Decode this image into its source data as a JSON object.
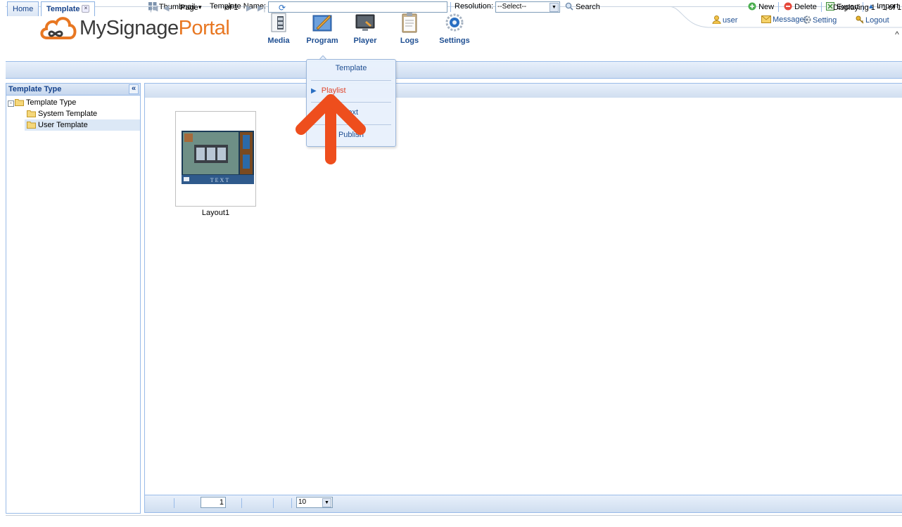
{
  "app": {
    "logo_text_1": "MySignage",
    "logo_text_2": "Portal"
  },
  "nav": [
    {
      "label": "Media",
      "icon": "film-document-icon"
    },
    {
      "label": "Program",
      "icon": "program-pen-icon"
    },
    {
      "label": "Player",
      "icon": "monitor-icon"
    },
    {
      "label": "Logs",
      "icon": "clipboard-icon"
    },
    {
      "label": "Settings",
      "icon": "gear-icon"
    }
  ],
  "topbar": {
    "user": "user",
    "message": "Message(",
    "setting": "Setting",
    "logout": "Logout"
  },
  "tabs": [
    {
      "label": "Home",
      "active": false
    },
    {
      "label": "Template",
      "active": true
    }
  ],
  "left_panel": {
    "title": "Template Type",
    "collapse_glyph": "«",
    "tree": {
      "root": "Template Type",
      "children": [
        "System Template",
        "User Template"
      ],
      "selected": "User Template"
    }
  },
  "toolbar": {
    "view_mode": "Thumbnail",
    "name_label": "Template Name:",
    "name_value": "",
    "resolution_label": "Resolution:",
    "resolution_selected": "--Select--",
    "search_label": "Search",
    "new_label": "New",
    "delete_label": "Delete",
    "export_label": "Export",
    "import_label": "Import"
  },
  "grid": {
    "items": [
      {
        "name": "Layout1",
        "thumb_text": "TEXT"
      }
    ]
  },
  "paging": {
    "page_label": "Page",
    "page_value": "1",
    "of_label": "of 1",
    "page_size": "10",
    "display_text": "Displaying 1 - 1 of 1"
  },
  "program_menu": {
    "items": [
      "Template",
      "Playlist",
      "Text",
      "Publish"
    ],
    "highlighted": "Playlist"
  },
  "colors": {
    "brand_orange": "#e87722",
    "nav_blue": "#1f4f92",
    "highlight_red": "#e0452a",
    "arrow_orange": "#ee4e1d"
  }
}
